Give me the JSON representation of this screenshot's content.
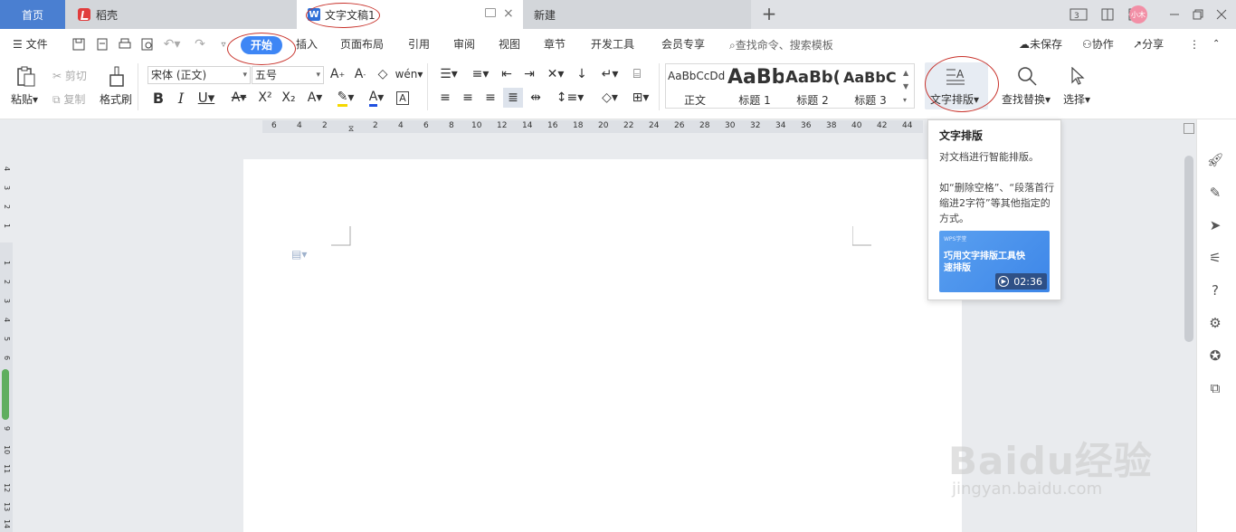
{
  "tabs": {
    "home": "首页",
    "daoke": "稻壳",
    "doc": "文字文稿1",
    "new": "新建"
  },
  "window": {
    "avatar": "小木"
  },
  "menu": {
    "file": "文件",
    "items": [
      "开始",
      "插入",
      "页面布局",
      "引用",
      "审阅",
      "视图",
      "章节",
      "开发工具",
      "会员专享"
    ],
    "search": "查找命令、搜索模板",
    "unsaved": "未保存",
    "collab": "协作",
    "share": "分享"
  },
  "ribbon": {
    "paste": "粘贴",
    "cut": "剪切",
    "copy": "复制",
    "format_painter": "格式刷",
    "font": "宋体 (正文)",
    "size": "五号",
    "styles": [
      {
        "sample": "AaBbCcDd",
        "label": "正文"
      },
      {
        "sample": "AaBb",
        "label": "标题 1"
      },
      {
        "sample": "AaBb(",
        "label": "标题 2"
      },
      {
        "sample": "AaBbC",
        "label": "标题 3"
      }
    ],
    "text_layout": "文字排版",
    "find_replace": "查找替换",
    "select": "选择"
  },
  "ruler": {
    "h_ticks": [
      "6",
      "4",
      "2",
      "",
      "2",
      "4",
      "6",
      "8",
      "10",
      "12",
      "14",
      "16",
      "18",
      "20",
      "22",
      "24",
      "26",
      "28",
      "30",
      "32",
      "34",
      "36",
      "38",
      "40",
      "42",
      "44"
    ],
    "v_ticks": [
      "4",
      "3",
      "2",
      "1",
      "",
      "1",
      "2",
      "3",
      "4",
      "5",
      "6",
      "7",
      "8",
      "9",
      "10",
      "11",
      "12",
      "13",
      "14",
      "15"
    ]
  },
  "tooltip": {
    "title": "文字排版",
    "line1": "对文档进行智能排版。",
    "line2": "如“删除空格”、“段落首行缩进2字符”等其他指定的方式。",
    "video_brand": "WPS学堂",
    "video_title": "巧用文字排版工具快速排版",
    "duration": "02:36"
  },
  "watermark": {
    "brand": "Baidu经验",
    "url": "jingyan.baidu.com"
  },
  "colors": {
    "accent": "#3e86f5",
    "annotation": "#c8322b",
    "home_tab": "#4a7fd1"
  }
}
